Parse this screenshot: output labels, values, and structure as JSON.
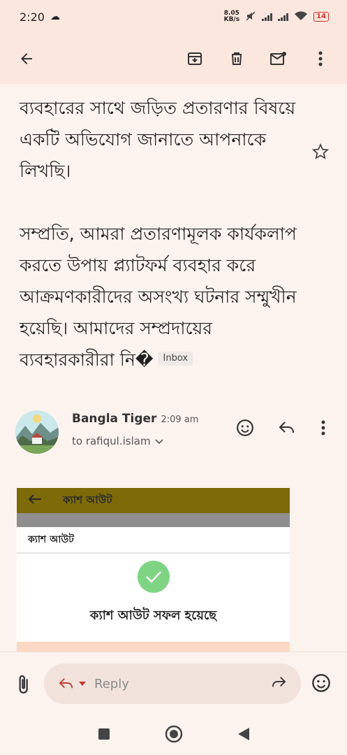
{
  "status": {
    "time": "2:20",
    "net_speed_value": "8.05",
    "net_speed_unit": "KB/s",
    "battery": "14"
  },
  "toolbar": {
    "back_icon": "arrow-back-icon",
    "archive_icon": "archive-icon",
    "delete_icon": "trash-icon",
    "mark_unread_icon": "mail-unread-icon",
    "more_icon": "more-vert-icon"
  },
  "email": {
    "paragraph1": "ব্যবহারের সাথে জড়িত প্রতারণার বিষয়ে একটি অভিযোগ জানাতে আপনাকে লিখছি।",
    "paragraph2": "সম্প্রতি, আমরা প্রতারণামূলক কার্যকলাপ করতে উপায় প্ল্যাটফর্ম ব্যবহার করে আক্রমণকারীদের অসংখ্য ঘটনার সম্মুখীন হয়েছি। আমাদের সম্প্রদায়ের ব্যবহারকারীরা নি�",
    "label": "Inbox"
  },
  "message": {
    "sender_name": "Bangla Tiger",
    "time": "2:09 am",
    "to": "to rafiqul.islam"
  },
  "attachment": {
    "header_title": "ক্যাশ আউট",
    "card_title": "ক্যাশ আউট",
    "success_message": "ক্যাশ আউট সফল হয়েছে",
    "accent_color": "#7d6a08",
    "success_color": "#7ed483"
  },
  "compose": {
    "reply_placeholder": "Reply"
  }
}
